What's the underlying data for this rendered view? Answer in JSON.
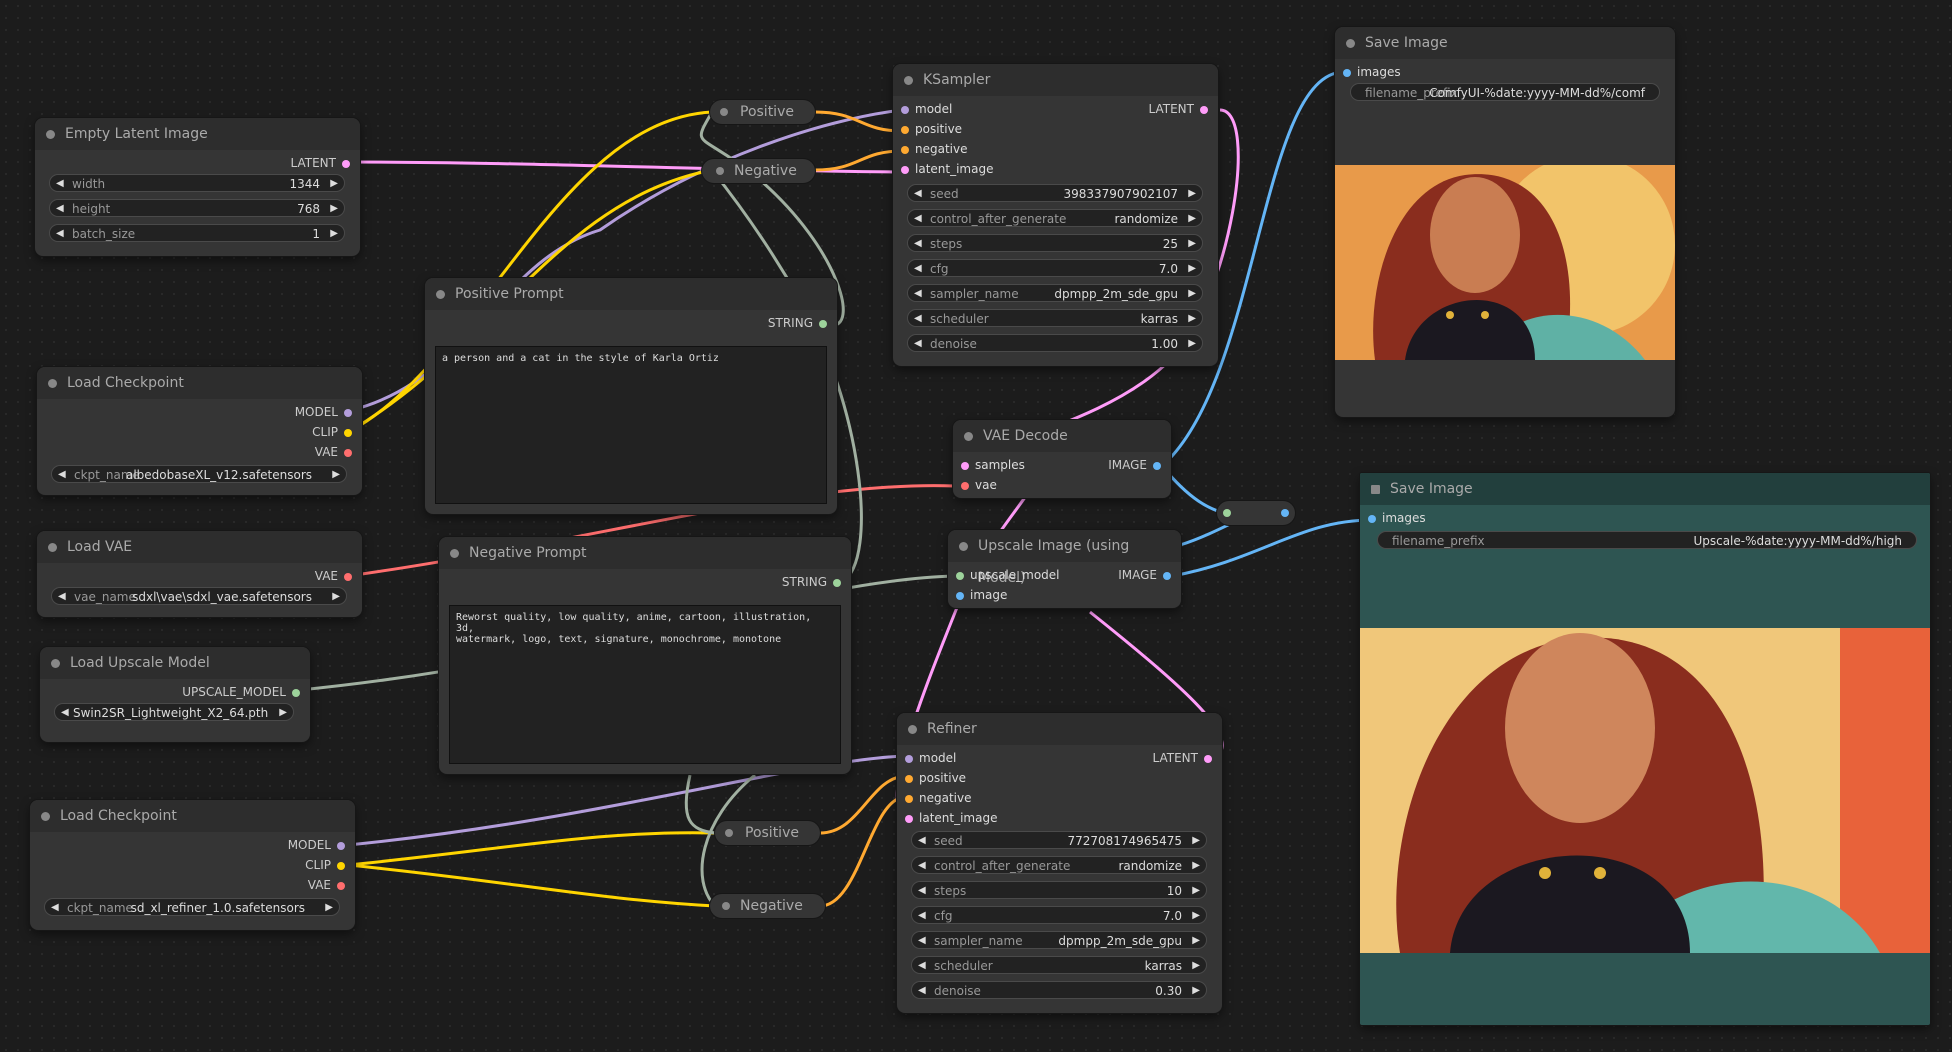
{
  "colors": {
    "model": "#b39ddb",
    "clip": "#ffd500",
    "vae": "#ff6e6e",
    "latent": "#ff9cf9",
    "image": "#64b5f6",
    "cond": "#ffa931",
    "string": "#9dd39b",
    "upscale": "#a1b0a1"
  },
  "empty_latent": {
    "title": "Empty Latent Image",
    "out": "LATENT",
    "width_label": "width",
    "width": "1344",
    "height_label": "height",
    "height": "768",
    "batch_label": "batch_size",
    "batch": "1"
  },
  "load_ckpt1": {
    "title": "Load Checkpoint",
    "out_model": "MODEL",
    "out_clip": "CLIP",
    "out_vae": "VAE",
    "ckpt_label": "ckpt_name",
    "ckpt": "albedobaseXL_v12.safetensors"
  },
  "load_vae": {
    "title": "Load VAE",
    "out": "VAE",
    "label": "vae_name",
    "value": "sdxl\\vae\\sdxl_vae.safetensors"
  },
  "load_upscale": {
    "title": "Load Upscale Model",
    "out": "UPSCALE_MODEL",
    "value": "Swin2SR_Lightweight_X2_64.pth"
  },
  "load_ckpt2": {
    "title": "Load Checkpoint",
    "out_model": "MODEL",
    "out_clip": "CLIP",
    "out_vae": "VAE",
    "ckpt_label": "ckpt_name",
    "ckpt": "sd_xl_refiner_1.0.safetensors"
  },
  "pos_prompt": {
    "title": "Positive Prompt",
    "out": "STRING",
    "text": "a person and a cat in the style of Karla Ortiz"
  },
  "neg_prompt": {
    "title": "Negative Prompt",
    "out": "STRING",
    "text": "Reworst quality, low quality, anime, cartoon, illustration, 3d,\nwatermark, logo, text, signature, monochrome, monotone"
  },
  "reroutes": {
    "pos1": "Positive",
    "neg1": "Negative",
    "pos2": "Positive",
    "neg2": "Negative"
  },
  "ksampler": {
    "title": "KSampler",
    "in_model": "model",
    "in_pos": "positive",
    "in_neg": "negative",
    "in_latent": "latent_image",
    "out": "LATENT",
    "seed_label": "seed",
    "seed": "398337907902107",
    "cag_label": "control_after_generate",
    "cag": "randomize",
    "steps_label": "steps",
    "steps": "25",
    "cfg_label": "cfg",
    "cfg": "7.0",
    "sampler_label": "sampler_name",
    "sampler": "dpmpp_2m_sde_gpu",
    "sched_label": "scheduler",
    "sched": "karras",
    "denoise_label": "denoise",
    "denoise": "1.00"
  },
  "refiner": {
    "title": "Refiner",
    "in_model": "model",
    "in_pos": "positive",
    "in_neg": "negative",
    "in_latent": "latent_image",
    "out": "LATENT",
    "seed_label": "seed",
    "seed": "772708174965475",
    "cag_label": "control_after_generate",
    "cag": "randomize",
    "steps_label": "steps",
    "steps": "10",
    "cfg_label": "cfg",
    "cfg": "7.0",
    "sampler_label": "sampler_name",
    "sampler": "dpmpp_2m_sde_gpu",
    "sched_label": "scheduler",
    "sched": "karras",
    "denoise_label": "denoise",
    "denoise": "0.30"
  },
  "vae_decode": {
    "title": "VAE Decode",
    "in_samples": "samples",
    "in_vae": "vae",
    "out": "IMAGE"
  },
  "upscale_img": {
    "title": "Upscale Image (using Model)",
    "in_model": "upscale_model",
    "in_image": "image",
    "out": "IMAGE"
  },
  "save1": {
    "title": "Save Image",
    "in": "images",
    "label": "filename_prefix",
    "value": "ComfyUI-%date:yyyy-MM-dd%/comf"
  },
  "save2": {
    "title": "Save Image",
    "in": "images",
    "label": "filename_prefix",
    "value": "Upscale-%date:yyyy-MM-dd%/high"
  }
}
